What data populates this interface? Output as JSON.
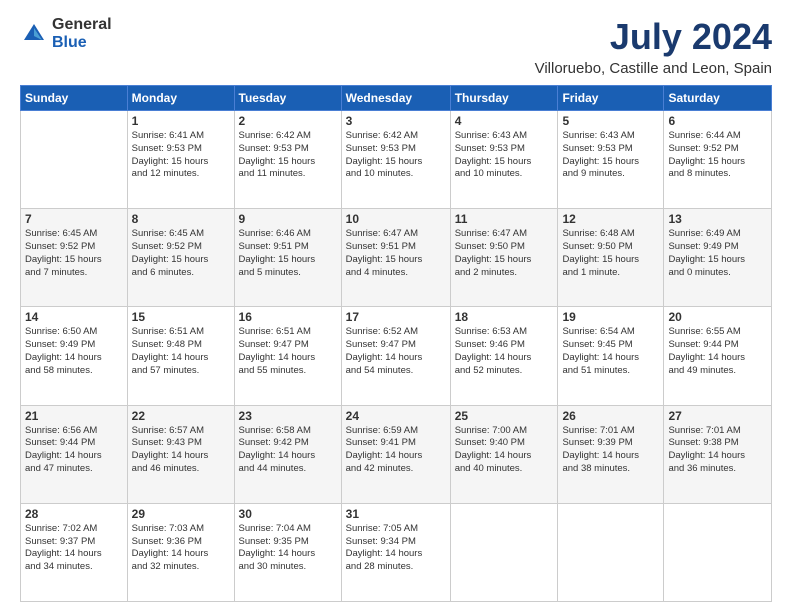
{
  "logo": {
    "general": "General",
    "blue": "Blue"
  },
  "title": "July 2024",
  "subtitle": "Villoruebo, Castille and Leon, Spain",
  "headers": [
    "Sunday",
    "Monday",
    "Tuesday",
    "Wednesday",
    "Thursday",
    "Friday",
    "Saturday"
  ],
  "weeks": [
    [
      {
        "date": "",
        "info": ""
      },
      {
        "date": "1",
        "info": "Sunrise: 6:41 AM\nSunset: 9:53 PM\nDaylight: 15 hours\nand 12 minutes."
      },
      {
        "date": "2",
        "info": "Sunrise: 6:42 AM\nSunset: 9:53 PM\nDaylight: 15 hours\nand 11 minutes."
      },
      {
        "date": "3",
        "info": "Sunrise: 6:42 AM\nSunset: 9:53 PM\nDaylight: 15 hours\nand 10 minutes."
      },
      {
        "date": "4",
        "info": "Sunrise: 6:43 AM\nSunset: 9:53 PM\nDaylight: 15 hours\nand 10 minutes."
      },
      {
        "date": "5",
        "info": "Sunrise: 6:43 AM\nSunset: 9:53 PM\nDaylight: 15 hours\nand 9 minutes."
      },
      {
        "date": "6",
        "info": "Sunrise: 6:44 AM\nSunset: 9:52 PM\nDaylight: 15 hours\nand 8 minutes."
      }
    ],
    [
      {
        "date": "7",
        "info": "Sunrise: 6:45 AM\nSunset: 9:52 PM\nDaylight: 15 hours\nand 7 minutes."
      },
      {
        "date": "8",
        "info": "Sunrise: 6:45 AM\nSunset: 9:52 PM\nDaylight: 15 hours\nand 6 minutes."
      },
      {
        "date": "9",
        "info": "Sunrise: 6:46 AM\nSunset: 9:51 PM\nDaylight: 15 hours\nand 5 minutes."
      },
      {
        "date": "10",
        "info": "Sunrise: 6:47 AM\nSunset: 9:51 PM\nDaylight: 15 hours\nand 4 minutes."
      },
      {
        "date": "11",
        "info": "Sunrise: 6:47 AM\nSunset: 9:50 PM\nDaylight: 15 hours\nand 2 minutes."
      },
      {
        "date": "12",
        "info": "Sunrise: 6:48 AM\nSunset: 9:50 PM\nDaylight: 15 hours\nand 1 minute."
      },
      {
        "date": "13",
        "info": "Sunrise: 6:49 AM\nSunset: 9:49 PM\nDaylight: 15 hours\nand 0 minutes."
      }
    ],
    [
      {
        "date": "14",
        "info": "Sunrise: 6:50 AM\nSunset: 9:49 PM\nDaylight: 14 hours\nand 58 minutes."
      },
      {
        "date": "15",
        "info": "Sunrise: 6:51 AM\nSunset: 9:48 PM\nDaylight: 14 hours\nand 57 minutes."
      },
      {
        "date": "16",
        "info": "Sunrise: 6:51 AM\nSunset: 9:47 PM\nDaylight: 14 hours\nand 55 minutes."
      },
      {
        "date": "17",
        "info": "Sunrise: 6:52 AM\nSunset: 9:47 PM\nDaylight: 14 hours\nand 54 minutes."
      },
      {
        "date": "18",
        "info": "Sunrise: 6:53 AM\nSunset: 9:46 PM\nDaylight: 14 hours\nand 52 minutes."
      },
      {
        "date": "19",
        "info": "Sunrise: 6:54 AM\nSunset: 9:45 PM\nDaylight: 14 hours\nand 51 minutes."
      },
      {
        "date": "20",
        "info": "Sunrise: 6:55 AM\nSunset: 9:44 PM\nDaylight: 14 hours\nand 49 minutes."
      }
    ],
    [
      {
        "date": "21",
        "info": "Sunrise: 6:56 AM\nSunset: 9:44 PM\nDaylight: 14 hours\nand 47 minutes."
      },
      {
        "date": "22",
        "info": "Sunrise: 6:57 AM\nSunset: 9:43 PM\nDaylight: 14 hours\nand 46 minutes."
      },
      {
        "date": "23",
        "info": "Sunrise: 6:58 AM\nSunset: 9:42 PM\nDaylight: 14 hours\nand 44 minutes."
      },
      {
        "date": "24",
        "info": "Sunrise: 6:59 AM\nSunset: 9:41 PM\nDaylight: 14 hours\nand 42 minutes."
      },
      {
        "date": "25",
        "info": "Sunrise: 7:00 AM\nSunset: 9:40 PM\nDaylight: 14 hours\nand 40 minutes."
      },
      {
        "date": "26",
        "info": "Sunrise: 7:01 AM\nSunset: 9:39 PM\nDaylight: 14 hours\nand 38 minutes."
      },
      {
        "date": "27",
        "info": "Sunrise: 7:01 AM\nSunset: 9:38 PM\nDaylight: 14 hours\nand 36 minutes."
      }
    ],
    [
      {
        "date": "28",
        "info": "Sunrise: 7:02 AM\nSunset: 9:37 PM\nDaylight: 14 hours\nand 34 minutes."
      },
      {
        "date": "29",
        "info": "Sunrise: 7:03 AM\nSunset: 9:36 PM\nDaylight: 14 hours\nand 32 minutes."
      },
      {
        "date": "30",
        "info": "Sunrise: 7:04 AM\nSunset: 9:35 PM\nDaylight: 14 hours\nand 30 minutes."
      },
      {
        "date": "31",
        "info": "Sunrise: 7:05 AM\nSunset: 9:34 PM\nDaylight: 14 hours\nand 28 minutes."
      },
      {
        "date": "",
        "info": ""
      },
      {
        "date": "",
        "info": ""
      },
      {
        "date": "",
        "info": ""
      }
    ]
  ]
}
